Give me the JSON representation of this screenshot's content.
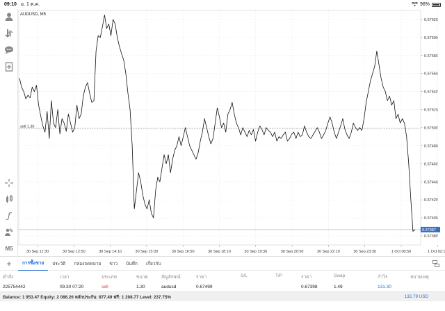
{
  "status_bar": {
    "time": "09:10",
    "date": "อ. 1 ต.ค.",
    "battery": "96%"
  },
  "left_tools": [
    {
      "name": "account-icon"
    },
    {
      "name": "trade-arrows-icon"
    },
    {
      "name": "chat-icon"
    },
    {
      "name": "new-order-icon"
    },
    {
      "name": "crosshair-icon"
    },
    {
      "name": "chart-type-icon"
    },
    {
      "name": "indicator-icon"
    },
    {
      "name": "objects-icon"
    },
    {
      "name": "timeframe",
      "label": "M5"
    }
  ],
  "chart": {
    "symbol_title": "AUDUSD, M5",
    "order_line_label": "sell 1.30",
    "current_price_tag": "0.67387",
    "colors": {
      "line": "#111111",
      "grid": "#e6e6e6",
      "order_line": "#a0a0a0",
      "price_line": "#8fb8e8",
      "price_tag_bg": "#3a6fc4"
    }
  },
  "chart_data": {
    "type": "line",
    "title": "AUDUSD, M5",
    "ylim": [
      0.6737,
      0.6763
    ],
    "y_ticks": [
      "0.67620",
      "0.67600",
      "0.67580",
      "0.67560",
      "0.67540",
      "0.67520",
      "0.67500",
      "0.67480",
      "0.67460",
      "0.67440",
      "0.67420",
      "0.67400",
      "0.67380"
    ],
    "x_ticks": [
      "30 Sep 11:30",
      "30 Sep 12:50",
      "30 Sep 14:10",
      "30 Sep 15:30",
      "30 Sep 16:50",
      "30 Sep 18:10",
      "30 Sep 19:30",
      "30 Sep 20:50",
      "30 Sep 22:10",
      "30 Sep 23:30",
      "1 Oct 00:50",
      "1 Oct 02:10"
    ],
    "order_level": 0.67499,
    "current_price": 0.67387,
    "series": [
      {
        "values": [
          0.67555,
          0.67545,
          0.6754,
          0.67532,
          0.67536,
          0.67533,
          0.67545,
          0.6754,
          0.67547,
          0.67525,
          0.67513,
          0.67502,
          0.67495,
          0.67518,
          0.67488,
          0.6753,
          0.67505,
          0.675,
          0.6752,
          0.67493,
          0.6751,
          0.67505,
          0.67496,
          0.67515,
          0.67505,
          0.67495,
          0.675,
          0.67525,
          0.6751,
          0.67515,
          0.67535,
          0.67545,
          0.6755,
          0.67538,
          0.67528,
          0.6753,
          0.67585,
          0.67602,
          0.676,
          0.67612,
          0.67625,
          0.6761,
          0.67615,
          0.67602,
          0.6762,
          0.67615,
          0.676,
          0.6759,
          0.67582,
          0.67575,
          0.6756,
          0.67538,
          0.6752,
          0.6748,
          0.6741,
          0.6743,
          0.6745,
          0.6744,
          0.67425,
          0.67415,
          0.6741,
          0.6742,
          0.67405,
          0.674,
          0.6743,
          0.67445,
          0.6744,
          0.67455,
          0.6747,
          0.6746,
          0.6747,
          0.6745,
          0.67465,
          0.67475,
          0.6748,
          0.6749,
          0.6748,
          0.6749,
          0.675,
          0.6749,
          0.6748,
          0.67475,
          0.6747,
          0.67465,
          0.67472,
          0.67485,
          0.67495,
          0.6751,
          0.675,
          0.6749,
          0.67482,
          0.67488,
          0.67505,
          0.67522,
          0.67512,
          0.675,
          0.67505,
          0.67495,
          0.67515,
          0.6752,
          0.67528,
          0.67515,
          0.67505,
          0.675,
          0.67492,
          0.675,
          0.67495,
          0.6749,
          0.67497,
          0.67492,
          0.67498,
          0.67485,
          0.67495,
          0.67502,
          0.67498,
          0.67492,
          0.675,
          0.67497,
          0.67495,
          0.6749,
          0.67495,
          0.67485,
          0.6749,
          0.67488,
          0.67492,
          0.67495,
          0.67485,
          0.67488,
          0.67493,
          0.67495,
          0.67488,
          0.67495,
          0.6749,
          0.67492,
          0.67502,
          0.67495,
          0.6749,
          0.67488,
          0.67492,
          0.67496,
          0.675,
          0.67495,
          0.67488,
          0.67492,
          0.67497,
          0.67505,
          0.67512,
          0.67505,
          0.67495,
          0.67488,
          0.67495,
          0.67502,
          0.6751,
          0.67498,
          0.67492,
          0.67488,
          0.67495,
          0.67505,
          0.675,
          0.67497,
          0.675,
          0.67497,
          0.6751,
          0.67528,
          0.6754,
          0.67552,
          0.6756,
          0.67568,
          0.67585,
          0.6757,
          0.67555,
          0.67545,
          0.6754,
          0.6753,
          0.67535,
          0.67525,
          0.6753,
          0.6751,
          0.67515,
          0.67505,
          0.6751,
          0.67505,
          0.6749,
          0.6746,
          0.6742,
          0.67385,
          0.67387
        ]
      }
    ]
  },
  "bottom_tabs": [
    {
      "label": "การซื้อขาย",
      "active": true
    },
    {
      "label": "ประวัติ",
      "active": false
    },
    {
      "label": "กล่องจดหมาย",
      "active": false
    },
    {
      "label": "ข่าว",
      "active": false
    },
    {
      "label": "บันทึก",
      "active": false
    },
    {
      "label": "เกี่ยวกับ",
      "active": false
    }
  ],
  "trade_table": {
    "headers": {
      "order": "คำสั่ง",
      "time": "เวลา",
      "type": "ประเภท",
      "size": "ขนาด",
      "symbol": "สัญลักษณ์",
      "price": "ราคา",
      "sl": "S/L",
      "tp": "T/P",
      "current_price": "ราคา",
      "swap": "Swap",
      "profit": "กำไร",
      "comment": "หมายเหตุ"
    },
    "rows": [
      {
        "order": "225754442",
        "time": "09.30 07:20",
        "type": "sell",
        "size": "1.30",
        "symbol": "audusd",
        "price": "0.67499",
        "sl": "",
        "tp": "",
        "current_price": "0.67398",
        "swap": "1.49",
        "profit": "131.30",
        "comment": ""
      }
    ]
  },
  "balance_bar": {
    "summary": "Balance: 1 953.47 Equity: 2 086.26 หลักประกัน: 877.49 ฟรี: 1 208.77 Level: 237.75%",
    "total": "132.79  USD"
  }
}
